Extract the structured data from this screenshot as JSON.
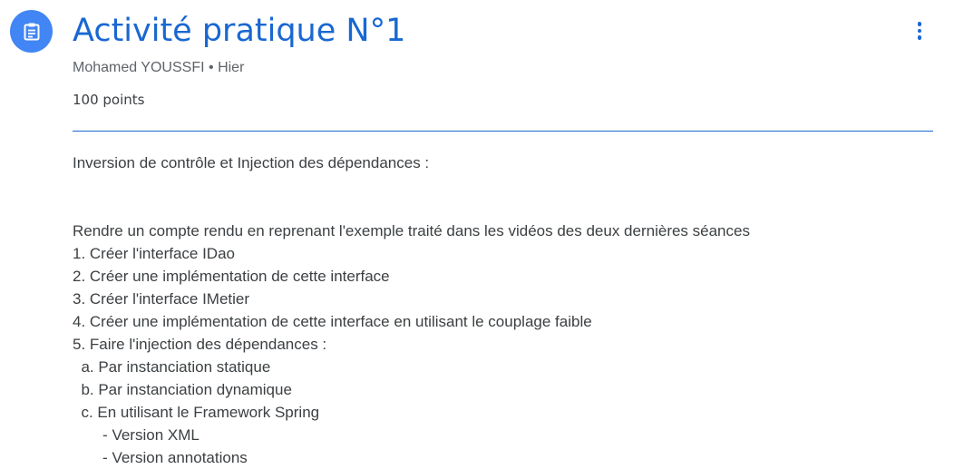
{
  "assignment": {
    "icon": "assignment-icon",
    "accent_color": "#1967d2",
    "icon_bg_color": "#4285f4",
    "title": "Activité pratique N°1",
    "author": "Mohamed YOUSSFI",
    "separator": "•",
    "posted": "Hier",
    "points": "100 points",
    "more_icon": "more-vert-icon"
  },
  "description": {
    "intro": "Inversion de contrôle et Injection des dépendances :",
    "lines": [
      "Rendre un compte rendu en reprenant l'exemple traité dans les vidéos des deux dernières séances",
      "1. Créer l'interface IDao",
      "2. Créer une implémentation de cette interface",
      "3. Créer l'interface IMetier",
      "4. Créer une implémentation de cette interface en utilisant le couplage faible",
      "5. Faire l'injection des dépendances :",
      "  a. Par instanciation statique",
      "  b. Par instanciation dynamique",
      "  c. En utilisant le Framework Spring",
      "       - Version XML",
      "       - Version annotations"
    ]
  }
}
